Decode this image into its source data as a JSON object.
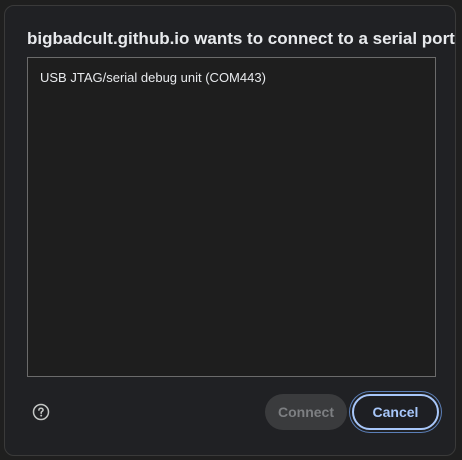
{
  "dialog": {
    "title": "bigbadcult.github.io wants to connect to a serial port",
    "ports": [
      {
        "label": "USB JTAG/serial debug unit (COM443)"
      }
    ],
    "help_icon": "help-circle-icon",
    "buttons": {
      "connect_label": "Connect",
      "connect_enabled": false,
      "cancel_label": "Cancel"
    }
  },
  "colors": {
    "accent": "#a8c7fa",
    "background": "#202124",
    "text": "#e8eaed",
    "disabled_text": "#7d7f82"
  }
}
